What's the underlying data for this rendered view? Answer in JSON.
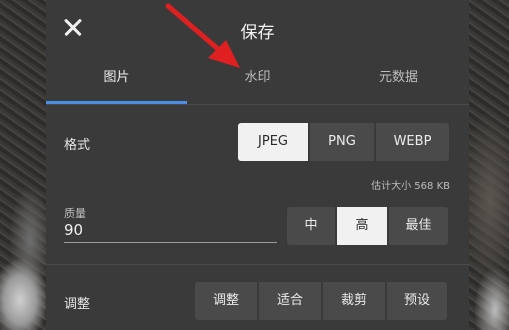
{
  "dialog": {
    "title": "保存"
  },
  "tabs": [
    {
      "label": "图片",
      "active": true
    },
    {
      "label": "水印",
      "active": false
    },
    {
      "label": "元数据",
      "active": false
    }
  ],
  "format": {
    "label": "格式",
    "options": [
      "JPEG",
      "PNG",
      "WEBP"
    ],
    "selected": "JPEG"
  },
  "size_estimate": "估计大小 568 KB",
  "quality": {
    "label": "质量",
    "value": "90",
    "levels": [
      "中",
      "高",
      "最佳"
    ],
    "selected": "高"
  },
  "adjust": {
    "label": "调整",
    "options": [
      "调整",
      "适合",
      "裁剪",
      "预设"
    ]
  },
  "colors": {
    "accent": "#4a8fe7",
    "annotation": "#e02020",
    "dialog_bg": "#3a3a3a",
    "selected_bg": "#f1f1f1"
  }
}
